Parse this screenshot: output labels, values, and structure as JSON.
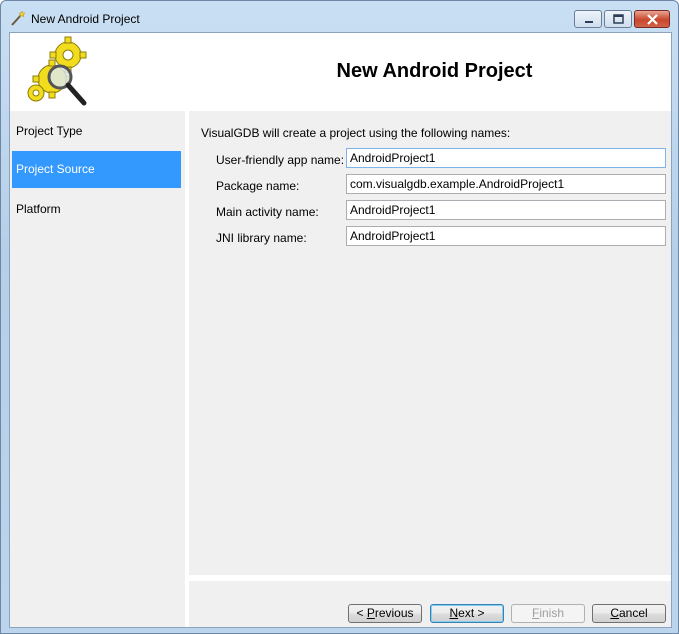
{
  "window": {
    "title": "New Android Project",
    "icon": "wand-icon",
    "controls": [
      "minimize-icon",
      "maximize-icon",
      "close-icon"
    ]
  },
  "header": {
    "title": "New Android Project",
    "logo": "gears-magnifier-icon"
  },
  "sidebar": {
    "items": [
      {
        "label": "Project Type",
        "selected": false
      },
      {
        "label": "Project Source",
        "selected": true
      },
      {
        "label": "Platform",
        "selected": false
      }
    ],
    "selected_color": "#3399ff"
  },
  "main": {
    "intro": "VisualGDB will create a project using the following names:",
    "fields": [
      {
        "label": "User-friendly app name:",
        "value": "AndroidProject1"
      },
      {
        "label": "Package name:",
        "value": "com.visualgdb.example.AndroidProject1"
      },
      {
        "label": "Main activity name:",
        "value": "AndroidProject1"
      },
      {
        "label": "JNI library name:",
        "value": "AndroidProject1"
      }
    ]
  },
  "footer": {
    "previous": {
      "prefix": "< ",
      "accel": "P",
      "rest": "revious"
    },
    "next": {
      "accel": "N",
      "rest": "ext >"
    },
    "finish": {
      "accel": "F",
      "rest": "inish"
    },
    "cancel": {
      "accel": "C",
      "rest": "ancel"
    }
  }
}
